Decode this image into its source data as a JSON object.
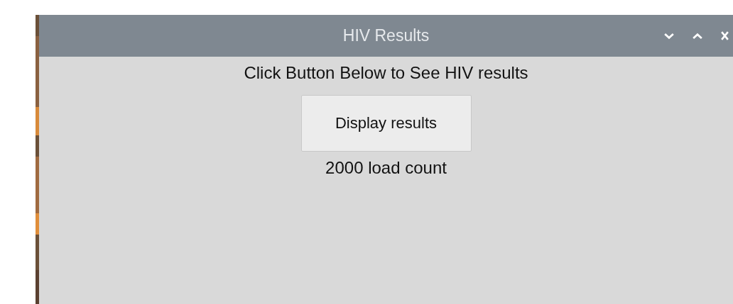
{
  "window": {
    "title": "HIV Results"
  },
  "content": {
    "instruction": "Click Button Below to See HIV results",
    "button": "Display results",
    "result": "2000 load count"
  }
}
